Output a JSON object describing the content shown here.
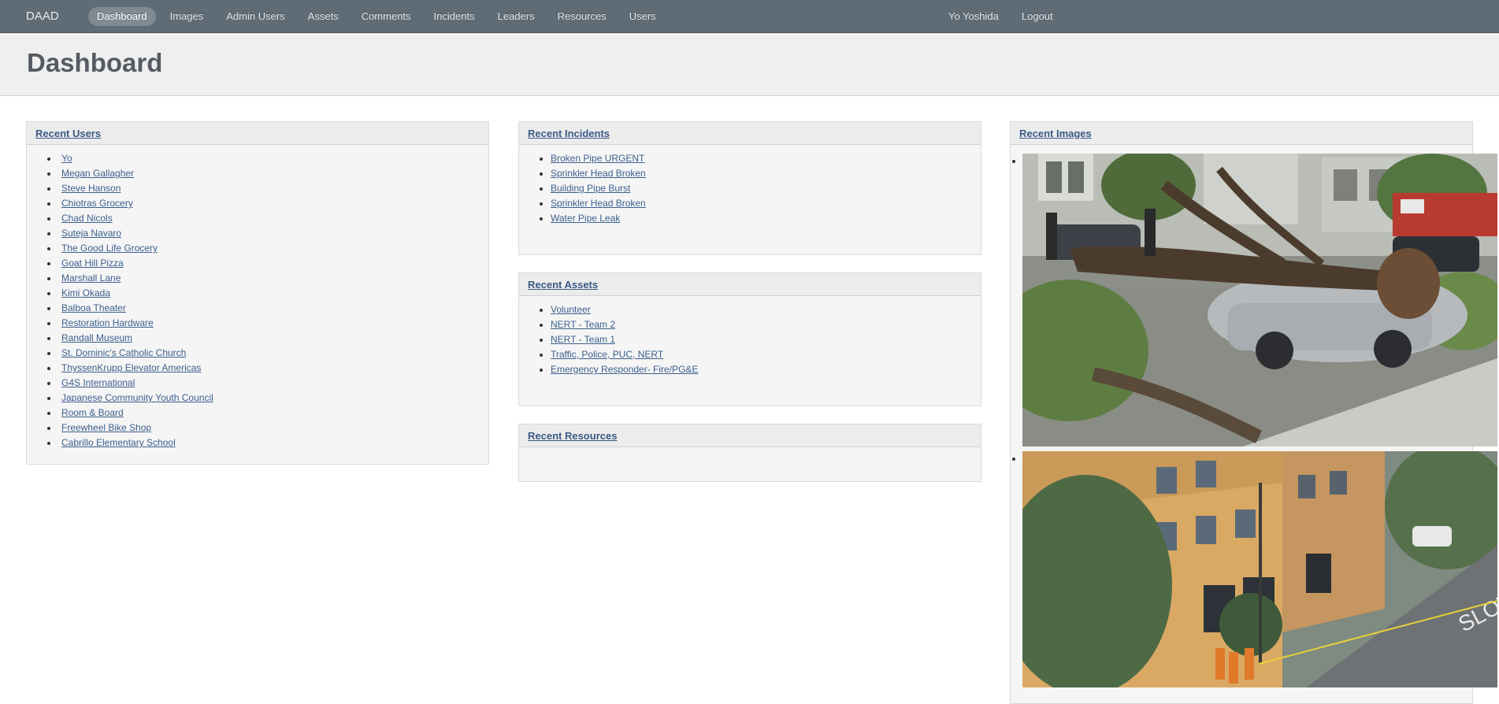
{
  "nav": {
    "brand": "DAAD",
    "links": [
      "Dashboard",
      "Images",
      "Admin Users",
      "Assets",
      "Comments",
      "Incidents",
      "Leaders",
      "Resources",
      "Users"
    ],
    "active": "Dashboard",
    "user_name": "Yo Yoshida",
    "logout_label": "Logout"
  },
  "page": {
    "title": "Dashboard"
  },
  "panels": {
    "users": {
      "title": "Recent Users",
      "items": [
        "Yo",
        "Megan Gallagher",
        "Steve Hanson",
        "Chiotras Grocery",
        "Chad Nicols",
        "Suteja Navaro",
        "The Good Life Grocery",
        "Goat Hill Pizza",
        "Marshall Lane",
        "Kimi Okada",
        "Balboa Theater",
        "Restoration Hardware",
        "Randall Museum",
        "St. Dominic's Catholic Church",
        "ThyssenKrupp Elevator Americas",
        "G4S International",
        "Japanese Community Youth Council",
        "Room & Board",
        "Freewheel Bike Shop",
        "Cabrillo Elementary School"
      ]
    },
    "incidents": {
      "title": "Recent Incidents",
      "items": [
        "Broken Pipe URGENT",
        "Sprinkler Head Broken",
        "Building Pipe Burst",
        "Sprinkler Head Broken",
        "Water Pipe Leak"
      ]
    },
    "assets": {
      "title": "Recent Assets",
      "items": [
        "Volunteer",
        "NERT - Team 2",
        "NERT - Team 1",
        "Traffic, Police, PUC, NERT",
        "Emergency Responder- Fire/PG&E"
      ]
    },
    "resources": {
      "title": "Recent Resources",
      "items": []
    },
    "images": {
      "title": "Recent Images"
    }
  },
  "colors": {
    "nav_bg": "#5f6b75",
    "link": "#3b5f8c",
    "panel_bg": "#f5f5f5",
    "header_bg": "#efefef"
  }
}
